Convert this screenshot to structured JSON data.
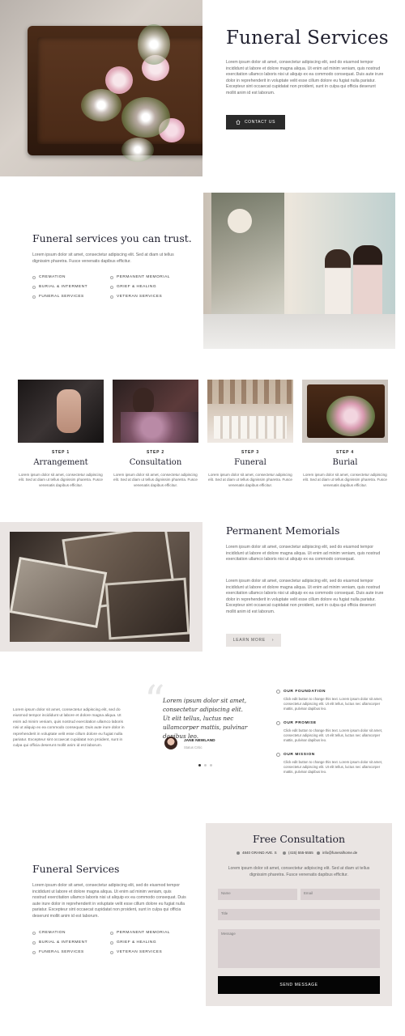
{
  "hero": {
    "title": "Funeral Services",
    "text": "Lorem ipsum dolor sit amet, consectetur adipiscing elit, sed do eiusmod tempor incididunt ut labore et dolore magna aliqua. Ut enim ad minim veniam, quis nostrud exercitation ullamco laboris nisi ut aliquip ex ea commodo consequat. Duis aute irure dolor in reprehenderit in voluptate velit esse cillum dolore eu fugiat nulla pariatur. Excepteur sint occaecat cupidatat non proident, sunt in culpa qui officia deserunt mollit anim id est laborum.",
    "button": "CONTACT US",
    "button_icon": "home-icon"
  },
  "trust": {
    "title": "Funeral services you can trust.",
    "text": "Lorem ipsum dolor sit amet, consectetur adipiscing elit. Sed at diam ut tellus dignissim pharetra. Fusce venenatis dapibus efficitur.",
    "services": [
      "CREMATION",
      "PERMANENT MEMORIAL",
      "BURIAL & INTERMENT",
      "GRIEF & HEALING",
      "FUNERAL SERVICES",
      "VETERAN SERVICES"
    ]
  },
  "steps": [
    {
      "label": "STEP 1",
      "title": "Arrangement",
      "text": "Lorem ipsum dolor sit amet, consectetur adipiscing elit. Sed at diam ut tellus dignissim pharetra. Fusce venenatis dapibus efficitur."
    },
    {
      "label": "STEP 2",
      "title": "Consultation",
      "text": "Lorem ipsum dolor sit amet, consectetur adipiscing elit. Sed at diam ut tellus dignissim pharetra. Fusce venenatis dapibus efficitur."
    },
    {
      "label": "STEP 3",
      "title": "Funeral",
      "text": "Lorem ipsum dolor sit amet, consectetur adipiscing elit. Sed at diam ut tellus dignissim pharetra. Fusce venenatis dapibus efficitur."
    },
    {
      "label": "STEP 4",
      "title": "Burial",
      "text": "Lorem ipsum dolor sit amet, consectetur adipiscing elit. Sed at diam ut tellus dignissim pharetra. Fusce venenatis dapibus efficitur."
    }
  ],
  "memorials": {
    "title": "Permanent Memorials",
    "text1": "Lorem ipsum dolor sit amet, consectetur adipiscing elit, sed do eiusmod tempor incididunt ut labore et dolore magna aliqua. Ut enim ad minim veniam, quis nostrud exercitation ullamco laboris nisi ut aliquip ex ea commodo consequat.",
    "text2": "Lorem ipsum dolor sit amet, consectetur adipiscing elit, sed do eiusmod tempor incididunt ut labore et dolore magna aliqua. Ut enim ad minim veniam, quis nostrud exercitation ullamco laboris nisi ut aliquip ex ea commodo consequat. Duis aute irure dolor in reprehenderit in voluptate velit esse cillum dolore eu fugiat nulla pariatur. Excepteur sint occaecat cupidatat non proident, sunt in culpa qui officia deserunt mollit anim id est laborum.",
    "button": "LEARN MORE",
    "button_arrow": "›"
  },
  "testimonial": {
    "intro": "Lorem ipsum dolor sit amet, consectetur adipiscing elit, sed do eiusmod tempor incididunt ut labore et dolore magna aliqua. Ut enim ad minim veniam, quis nostrud exercitation ullamco laboris nisi ut aliquip ex ea commodo consequat. Duis aute irure dolor in reprehenderit in voluptate velit esse cillum dolore eu fugiat nulla pariatur. Excepteur sint occaecat cupidatat non proident, sunt in culpa qui officia deserunt mollit anim id est laborum.",
    "quote_mark": "“",
    "quote": "Lorem ipsum dolor sit amet, consectetur adipiscing elit. Ut elit tellus, luctus nec ullamcorper mattis, pulvinar dapibus leo.",
    "name": "JANE NEWLAND",
    "role": "Status Critic"
  },
  "features": [
    {
      "title": "OUR FOUNDATION",
      "text": "Click edit button to change this text. Lorem ipsum dolor sit amet, consectetur adipiscing elit. Ut elit tellus, luctus nec ullamcorper mattis, pulvinar dapibus leo."
    },
    {
      "title": "OUR PROMISE",
      "text": "Click edit button to change this text. Lorem ipsum dolor sit amet, consectetur adipiscing elit. Ut elit tellus, luctus nec ullamcorper mattis, pulvinar dapibus leo."
    },
    {
      "title": "OUR MISSION",
      "text": "Click edit button to change this text. Lorem ipsum dolor sit amet, consectetur adipiscing elit. Ut elit tellus, luctus nec ullamcorper mattis, pulvinar dapibus leo."
    }
  ],
  "bottom": {
    "title": "Funeral Services",
    "text": "Lorem ipsum dolor sit amet, consectetur adipiscing elit, sed do eiusmod tempor incididunt ut labore et dolore magna aliqua. Ut enim ad minim veniam, quis nostrud exercitation ullamco laboris nisi ut aliquip ex ea commodo consequat. Duis aute irure dolor in reprehenderit in voluptate velit esse cillum dolore eu fugiat nulla pariatur. Excepteur sint occaecat cupidatat non proident, sunt in culpa qui officia deserunt mollit anim id est laborum.",
    "services": [
      "CREMATION",
      "PERMANENT MEMORIAL",
      "BURIAL & INTERMENT",
      "GRIEF & HEALING",
      "FUNERAL SERVICES",
      "VETERAN SERVICES"
    ]
  },
  "form": {
    "title": "Free Consultation",
    "address": "4840 GRAND AVE. S",
    "phone": "(415) 555-5555",
    "email": "info@funeralhome.de",
    "text": "Lorem ipsum dolor sit amet, consectetur adipiscing elit. Sed at diam ut tellus dignissim pharetra. Fusce venenatis dapibus efficitur.",
    "name_placeholder": "Name",
    "email_placeholder": "Email",
    "title_placeholder": "Title",
    "message_placeholder": "Message",
    "submit": "SEND MESSAGE"
  }
}
